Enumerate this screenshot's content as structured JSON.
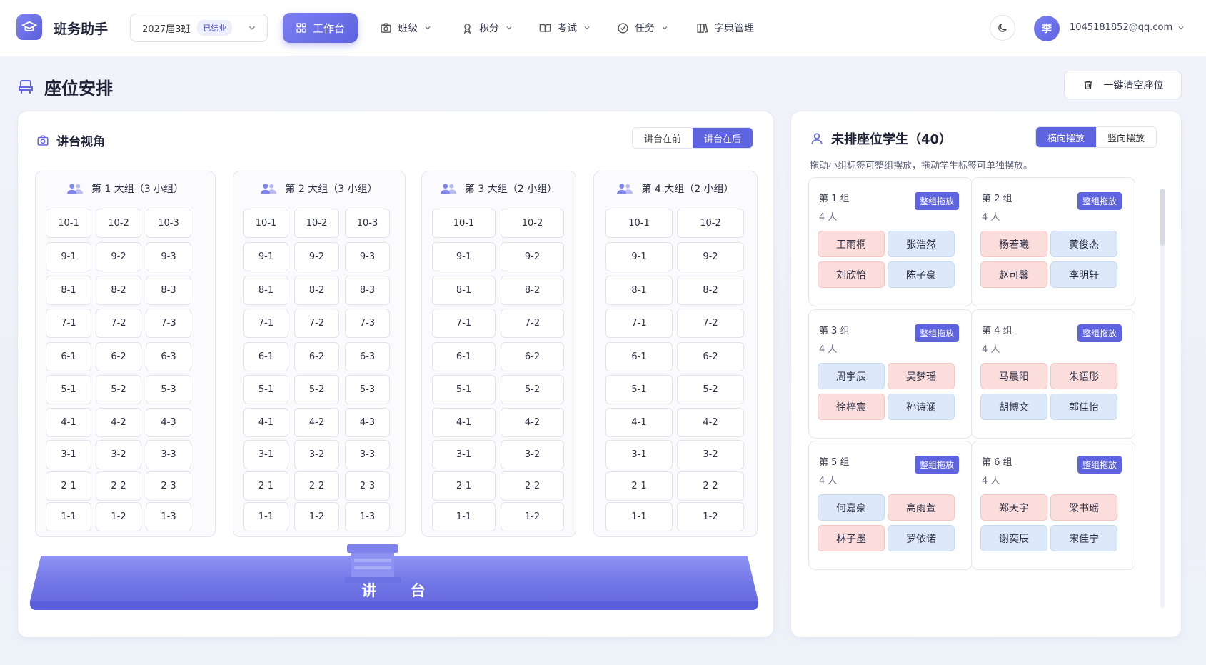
{
  "app": {
    "name": "班务助手",
    "class_name": "2027届3班",
    "class_status": "已结业"
  },
  "nav": {
    "workbench": "工作台",
    "items": [
      {
        "label": "班级",
        "icon": "camera-icon"
      },
      {
        "label": "积分",
        "icon": "award-icon"
      },
      {
        "label": "考试",
        "icon": "book-icon"
      },
      {
        "label": "任务",
        "icon": "check-circle-icon"
      },
      {
        "label": "字典管理",
        "icon": "books-icon"
      }
    ]
  },
  "user": {
    "avatar": "李",
    "email": "1045181852@qq.com"
  },
  "page": {
    "title": "座位安排",
    "clear_button": "一键清空座位"
  },
  "classroom": {
    "title": "讲台视角",
    "view_toggle": {
      "front": "讲台在前",
      "back": "讲台在后",
      "active": "back"
    },
    "podium": "讲 台",
    "groups": [
      {
        "title": "第 1 大组（3 小组）",
        "cols": 3
      },
      {
        "title": "第 2 大组（3 小组）",
        "cols": 3
      },
      {
        "title": "第 3 大组（2 小组）",
        "cols": 2
      },
      {
        "title": "第 4 大组（2 小组）",
        "cols": 2
      }
    ],
    "rows": [
      "10",
      "9",
      "8",
      "7",
      "6",
      "5",
      "4",
      "3",
      "2",
      "1"
    ]
  },
  "unseated": {
    "title": "未排座位学生（40）",
    "layout_toggle": {
      "horizontal": "横向摆放",
      "vertical": "竖向摆放",
      "active": "horizontal"
    },
    "hint": "拖动小组标签可整组摆放，拖动学生标签可单独摆放。",
    "drag_label": "整组拖放",
    "groups": [
      {
        "name": "第 1 组",
        "count": "4 人",
        "students": [
          {
            "name": "王雨桐",
            "g": "f"
          },
          {
            "name": "张浩然",
            "g": "m"
          },
          {
            "name": "刘欣怡",
            "g": "f"
          },
          {
            "name": "陈子豪",
            "g": "m"
          }
        ]
      },
      {
        "name": "第 2 组",
        "count": "4 人",
        "students": [
          {
            "name": "杨若曦",
            "g": "f"
          },
          {
            "name": "黄俊杰",
            "g": "m"
          },
          {
            "name": "赵可馨",
            "g": "f"
          },
          {
            "name": "李明轩",
            "g": "m"
          }
        ]
      },
      {
        "name": "第 3 组",
        "count": "4 人",
        "students": [
          {
            "name": "周宇辰",
            "g": "m"
          },
          {
            "name": "吴梦瑶",
            "g": "f"
          },
          {
            "name": "徐梓宸",
            "g": "f"
          },
          {
            "name": "孙诗涵",
            "g": "m"
          }
        ]
      },
      {
        "name": "第 4 组",
        "count": "4 人",
        "students": [
          {
            "name": "马晨阳",
            "g": "f"
          },
          {
            "name": "朱语彤",
            "g": "f"
          },
          {
            "name": "胡博文",
            "g": "m"
          },
          {
            "name": "郭佳怡",
            "g": "m"
          }
        ]
      },
      {
        "name": "第 5 组",
        "count": "4 人",
        "students": [
          {
            "name": "何嘉豪",
            "g": "m"
          },
          {
            "name": "高雨萱",
            "g": "f"
          },
          {
            "name": "林子墨",
            "g": "f"
          },
          {
            "name": "罗依诺",
            "g": "m"
          }
        ]
      },
      {
        "name": "第 6 组",
        "count": "4 人",
        "students": [
          {
            "name": "郑天宇",
            "g": "f"
          },
          {
            "name": "梁书瑶",
            "g": "f"
          },
          {
            "name": "谢奕辰",
            "g": "m"
          },
          {
            "name": "宋佳宁",
            "g": "m"
          }
        ]
      }
    ]
  },
  "colors": {
    "accent": "#5e63e0",
    "female_chip": "#fbdedc",
    "male_chip": "#dde9f8"
  }
}
